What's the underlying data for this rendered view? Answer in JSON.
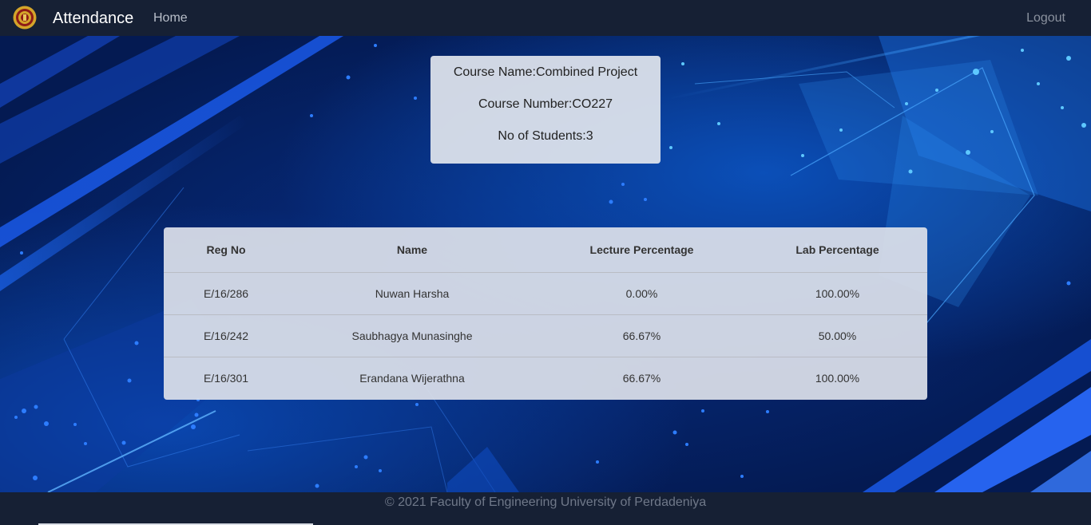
{
  "navbar": {
    "brand": "Attendance",
    "home_label": "Home",
    "logout_label": "Logout",
    "logo_icon": "university-crest-icon"
  },
  "course": {
    "name_line": "Course Name:Combined Project",
    "number_line": "Course Number:CO227",
    "students_line": "No of Students:3"
  },
  "table": {
    "headers": [
      "Reg No",
      "Name",
      "Lecture Percentage",
      "Lab Percentage"
    ],
    "rows": [
      [
        "E/16/286",
        "Nuwan Harsha",
        "0.00%",
        "100.00%"
      ],
      [
        "E/16/242",
        "Saubhagya Munasinghe",
        "66.67%",
        "50.00%"
      ],
      [
        "E/16/301",
        "Erandana Wijerathna",
        "66.67%",
        "100.00%"
      ]
    ]
  },
  "footer": {
    "text": "© 2021 Faculty of Engineering University of Perdadeniya"
  },
  "colors": {
    "navbar_bg": "#162034",
    "background_blue": "#072f86",
    "card_bg": "#e2e6ee"
  }
}
